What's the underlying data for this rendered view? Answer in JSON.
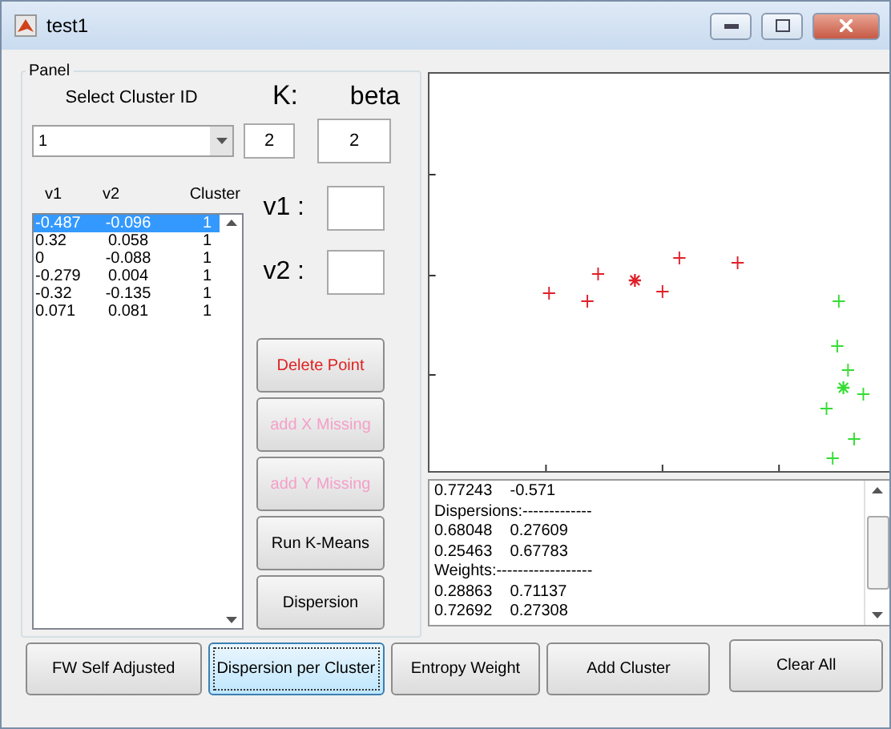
{
  "window": {
    "title": "test1"
  },
  "panel": {
    "title": "Panel",
    "cluster_select": {
      "label": "Select Cluster ID",
      "value": "1"
    },
    "k": {
      "label": "K:",
      "value": "2"
    },
    "beta": {
      "label": "beta",
      "value": "2"
    },
    "table": {
      "columns": [
        "v1",
        "v2",
        "Cluster"
      ],
      "rows": [
        {
          "cells": [
            "-0.487",
            "-0.096",
            "1"
          ],
          "selected": true
        },
        {
          "cells": [
            "0.32",
            "0.058",
            "1"
          ],
          "selected": false
        },
        {
          "cells": [
            "0",
            "-0.088",
            "1"
          ],
          "selected": false
        },
        {
          "cells": [
            "-0.279",
            "0.004",
            "1"
          ],
          "selected": false
        },
        {
          "cells": [
            "-0.32",
            "-0.135",
            "1"
          ],
          "selected": false
        },
        {
          "cells": [
            "0.071",
            "0.081",
            "1"
          ],
          "selected": false
        }
      ]
    },
    "v1": {
      "label": "v1 :"
    },
    "v2": {
      "label": "v2 :"
    },
    "buttons": [
      {
        "label": "Delete Point",
        "kind": "danger",
        "disabled": false
      },
      {
        "label": "add X Missing",
        "kind": "normal",
        "disabled": true
      },
      {
        "label": "add Y Missing",
        "kind": "normal",
        "disabled": true
      },
      {
        "label": "Run K-Means",
        "kind": "normal",
        "disabled": false
      },
      {
        "label": "Dispersion",
        "kind": "normal",
        "disabled": false
      }
    ]
  },
  "output": {
    "lines": [
      "0.77243    -0.571",
      "Dispersions:-------------",
      "0.68048    0.27609",
      "0.25463    0.67783",
      "Weights:------------------",
      "0.28863    0.71137",
      "0.72692    0.27308"
    ]
  },
  "bottom_buttons": [
    {
      "label": "FW Self Adjusted",
      "selected": false
    },
    {
      "label": "Dispersion per Cluster",
      "selected": true
    },
    {
      "label": "Entropy Weight",
      "selected": false
    },
    {
      "label": "Add Cluster",
      "selected": false
    },
    {
      "label": "Clear All",
      "selected": false
    }
  ]
}
